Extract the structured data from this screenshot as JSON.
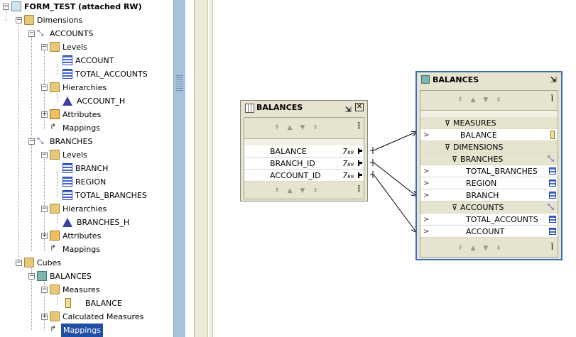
{
  "tree": {
    "root": "FORM_TEST (attached RW)",
    "dimensions": "Dimensions",
    "accounts": "ACCOUNTS",
    "levels": "Levels",
    "account": "ACCOUNT",
    "total_accounts": "TOTAL_ACCOUNTS",
    "hierarchies": "Hierarchies",
    "account_h": "ACCOUNT_H",
    "attributes": "Attributes",
    "mappings": "Mappings",
    "branches": "BRANCHES",
    "branch": "BRANCH",
    "region": "REGION",
    "total_branches": "TOTAL_BRANCHES",
    "branches_h": "BRANCHES_H",
    "cubes": "Cubes",
    "balances": "BALANCES",
    "measures": "Measures",
    "balance": "BALANCE",
    "calculated_measures": "Calculated Measures",
    "mappings_selected": "Mappings"
  },
  "table_box": {
    "title": "BALANCES",
    "columns": [
      {
        "name": "BALANCE",
        "type_tag": "7₈₉"
      },
      {
        "name": "BRANCH_ID",
        "type_tag": "7₈₉"
      },
      {
        "name": "ACCOUNT_ID",
        "type_tag": "7₈₉"
      }
    ],
    "nav": "⇞ ▲ ▼ ⇟"
  },
  "cube_box": {
    "title": "BALANCES",
    "measures_section": "MEASURES",
    "balance": "BALANCE",
    "dimensions_section": "DIMENSIONS",
    "branches": "BRANCHES",
    "total_branches": "TOTAL_BRANCHES",
    "region": "REGION",
    "branch": "BRANCH",
    "accounts": "ACCOUNTS",
    "total_accounts": "TOTAL_ACCOUNTS",
    "account": "ACCOUNT",
    "nav": "⇞ ▲ ▼ ⇟"
  },
  "colors": {
    "selection": "#1f4fa6",
    "cube_border": "#3a6ec0",
    "box_bg": "#e6e3cf",
    "scrollbar": "#a9c3dd"
  }
}
